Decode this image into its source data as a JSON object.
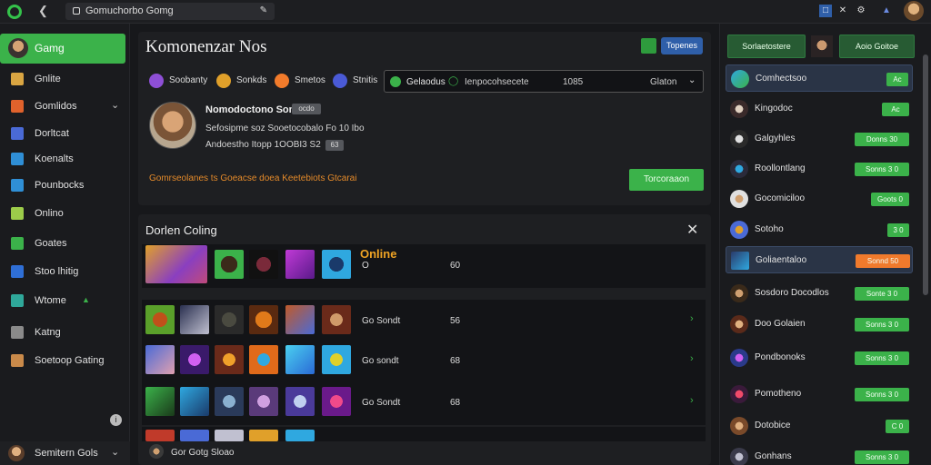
{
  "topbar": {
    "address": "Gomuchorbo Gomg",
    "icons": [
      "green-logo-icon",
      "back-icon",
      "blue-square-icon",
      "close-x-icon",
      "settings-icon",
      "network-icon",
      "user-avatar"
    ]
  },
  "sidebar": {
    "active_label": "Gamg",
    "items": [
      {
        "label": "Gnlite",
        "icon": "controller-icon"
      },
      {
        "label": "Gomlidos",
        "icon": "flame-icon"
      },
      {
        "label": "Dorltcat",
        "icon": "chat-icon"
      },
      {
        "label": "Koenalts",
        "icon": "shop-icon"
      },
      {
        "label": "Pounbocks",
        "icon": "puzzle-icon"
      },
      {
        "label": "Onlino",
        "icon": "globe-icon"
      },
      {
        "label": "Goates",
        "icon": "trophy-icon"
      },
      {
        "label": "Stoo lhitig",
        "icon": "store-icon"
      },
      {
        "label": "Wtome",
        "icon": "friends-icon"
      },
      {
        "label": "Katng",
        "icon": "gift-icon"
      },
      {
        "label": "Soetoop Gating",
        "icon": "settings-icon"
      }
    ],
    "bottom_label": "Semitern Gols"
  },
  "profile": {
    "title": "Komonenzar Nos",
    "header_button": "Topenes",
    "chips": [
      {
        "label": "Soobanty",
        "color": "#8e4fd6"
      },
      {
        "label": "Sonkds",
        "color": "#e0a02a"
      },
      {
        "label": "Smetos",
        "color": "#f27b2b"
      },
      {
        "label": "Stnitis",
        "color": "#4a5ad6"
      }
    ],
    "select": {
      "label": "Gelaodus",
      "mid": "Ienpocohsecete",
      "right_text": "1085",
      "end_text": "Glaton"
    },
    "name": "Nomodoctono Sone",
    "badge": "ocdo",
    "line2": "Sefosipme soz Sooetocobalo Fo 10 Ibo",
    "line3": "Andoestho Itopp 1OOBI3 S2",
    "badge2": "63",
    "warning": "Gomrseolanes ts Goeacse doea Keetebiots Gtcarai",
    "action_button": "Torcoraaon"
  },
  "games": {
    "title": "Dorlen Coling",
    "online_label": "Online",
    "rows": [
      {
        "label": "O",
        "count": "60"
      },
      {
        "label": "Go Sondt",
        "count": "56"
      },
      {
        "label": "Go sondt",
        "count": "68"
      },
      {
        "label": "Go Sondt",
        "count": "68"
      }
    ],
    "last_row_label": "Gor Gotg Sloao"
  },
  "right_panel": {
    "tab1": "Sorlaetostere",
    "tab2": "Aoio Goitoe",
    "friends": [
      {
        "name": "Comhectsoo",
        "badge": "Ac"
      },
      {
        "name": "Kingodoc",
        "badge": "Ac"
      },
      {
        "name": "Galgyhles",
        "badge": "Donns 30"
      },
      {
        "name": "Roollontlang",
        "badge": "Sonns 3 0"
      },
      {
        "name": "Gocomiciloo",
        "badge": "Goots 0"
      },
      {
        "name": "Sotoho",
        "badge": "3 0"
      },
      {
        "name": "Goliaentaloo",
        "badge": "Sonnd 50"
      },
      {
        "name": "Sosdoro Docodlos",
        "badge": "Sonte 3 0"
      },
      {
        "name": "Doo Golaien",
        "badge": "Sonns 3 0"
      },
      {
        "name": "Pondbonoks",
        "badge": "Sonns 3 0"
      },
      {
        "name": "Pomotheno",
        "badge": "Sonns 3 0"
      },
      {
        "name": "Dotobice",
        "badge": "C 0"
      },
      {
        "name": "Gonhans",
        "badge": "Sonns 3 0"
      }
    ]
  },
  "colors": {
    "accent_green": "#3bb24a",
    "warning_orange": "#e48a2a",
    "online_orange": "#f0a424"
  }
}
